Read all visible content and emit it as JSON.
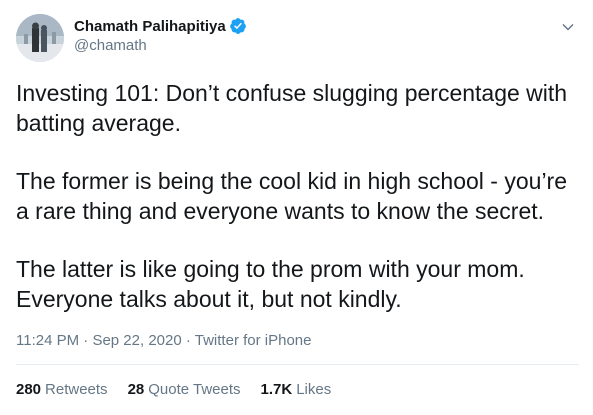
{
  "author": {
    "display_name": "Chamath Palihapitiya",
    "handle": "@chamath",
    "verified": true,
    "verified_color": "#1da1f2"
  },
  "tweet": {
    "paragraphs": [
      "Investing 101: Don’t confuse slugging percentage with batting average.",
      "The former is being the cool kid in high school - you’re a rare thing and everyone wants to know the secret.",
      "The latter is like going to the prom with your mom. Everyone talks about it, but not kindly."
    ],
    "time": "11:24 PM",
    "date": "Sep 22, 2020",
    "source": "Twitter for iPhone",
    "separator": "·"
  },
  "stats": {
    "retweets_count": "280",
    "retweets_label": "Retweets",
    "quotes_count": "28",
    "quotes_label": "Quote Tweets",
    "likes_count": "1.7K",
    "likes_label": "Likes"
  },
  "icons": {
    "verified": "verified-badge-icon",
    "more": "chevron-down-icon"
  },
  "colors": {
    "text": "#14171a",
    "secondary": "#657786",
    "divider": "#e6ecf0"
  }
}
